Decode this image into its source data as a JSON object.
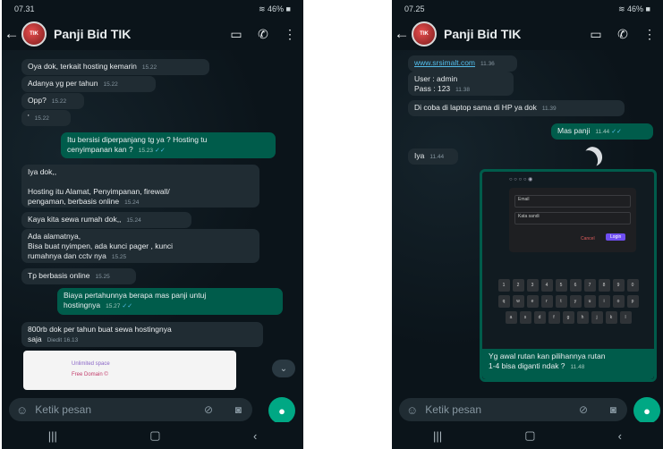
{
  "left": {
    "status": {
      "time": "07.31",
      "right": "≋ 46% ■"
    },
    "contact": "Panji Bid TIK",
    "messages": [
      {
        "side": "in",
        "text": "Oya dok, terkait hosting kemarin",
        "time": "15.22"
      },
      {
        "side": "in",
        "text": "Adanya yg per tahun",
        "time": "15.22"
      },
      {
        "side": "in",
        "text": "Opp?",
        "time": "15.22"
      },
      {
        "side": "in",
        "text": "'",
        "time": "15.22"
      },
      {
        "side": "out",
        "text": "Itu bersisi diperpanjang tg ya ? Hosting tu\ncenyimpanan kan ?",
        "time": "15.23"
      },
      {
        "side": "in",
        "text": "Iya dok,,\n\nHosting itu Alamat, Penyimpanan, firewall/\npengaman, berbasis online",
        "time": "15.24"
      },
      {
        "side": "in",
        "text": "Kaya kita sewa rumah dok,,",
        "time": "15.24"
      },
      {
        "side": "in",
        "text": "Ada alamatnya,\nBisa buat nyimpen, ada kunci pager , kunci\nrumahnya dan cctv nya",
        "time": "15.25"
      },
      {
        "side": "in",
        "text": "Tp berbasis online",
        "time": "15.25"
      },
      {
        "side": "out",
        "text": "Biaya pertahunnya berapa mas panji untuj\nhostingnya",
        "time": "15.27"
      },
      {
        "side": "in",
        "text": "800rb dok per tahun buat sewa hostingnya\nsaja",
        "time": "Diedit 16.13"
      }
    ],
    "preview": {
      "row1": "Unlimited space",
      "row2": "Free Domain ©"
    },
    "input_placeholder": "Ketik pesan"
  },
  "right": {
    "status": {
      "time": "07.25",
      "right": "≋ 46% ■"
    },
    "contact": "Panji Bid TIK",
    "messages": [
      {
        "side": "in",
        "text": "www.srsimalt.com",
        "time": "11.36"
      },
      {
        "side": "in",
        "text": "User : admin\nPass : 123",
        "time": "11.38"
      },
      {
        "side": "in",
        "text": "Di coba di laptop sama di HP ya dok",
        "time": "11.39"
      },
      {
        "side": "out",
        "text": "Mas panji",
        "time": "11.44"
      },
      {
        "side": "in",
        "text": "Iya",
        "time": "11.44"
      }
    ],
    "shared_caption": "Yg awal rutan kan pilihannya rutan\n1-4 bisa diganti ndak ?",
    "shared_time": "11.48",
    "dialog": {
      "field1": "Email",
      "field2": "Kata sandi",
      "cancel": "Cancel",
      "login": "Login"
    },
    "keyboard_rows": [
      [
        "1",
        "2",
        "3",
        "4",
        "5",
        "6",
        "7",
        "8",
        "9",
        "0"
      ],
      [
        "q",
        "w",
        "e",
        "r",
        "t",
        "y",
        "u",
        "i",
        "o",
        "p"
      ],
      [
        "a",
        "s",
        "d",
        "f",
        "g",
        "h",
        "j",
        "k",
        "l"
      ]
    ],
    "input_placeholder": "Ketik pesan"
  },
  "nav": {
    "recent": "|||",
    "home": "▢",
    "back": "‹"
  }
}
